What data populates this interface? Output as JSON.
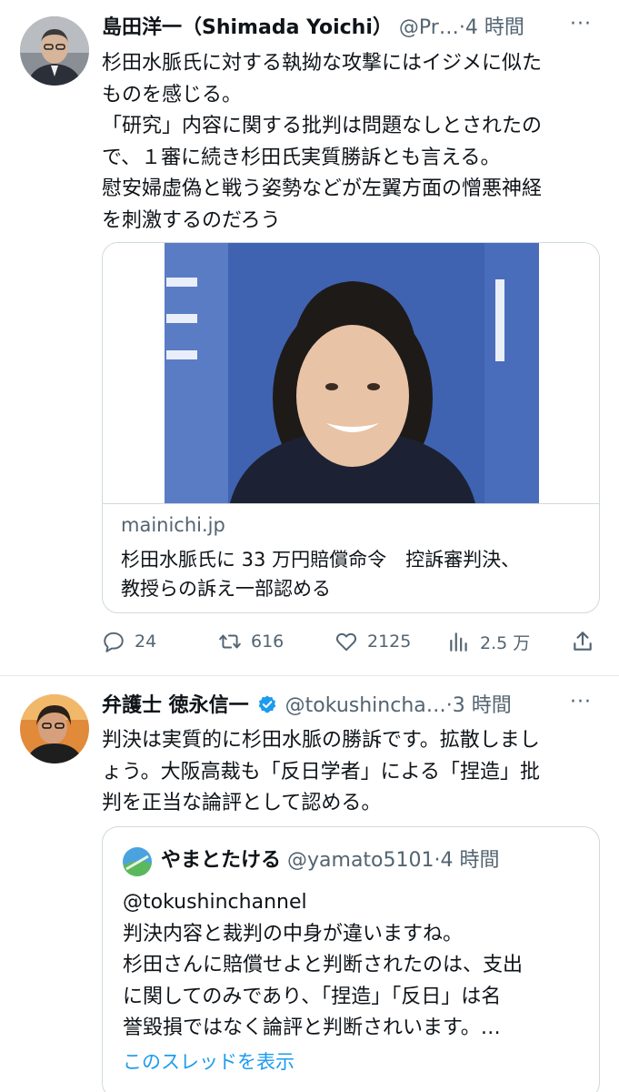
{
  "tweet1": {
    "name": "島田洋一（Shimada Yoichi）",
    "handle": "@Pr…",
    "dot": "·",
    "time": "4 時間",
    "more": "···",
    "lines": [
      "杉田水脈氏に対する執拗な攻撃にはイジメに似た",
      "ものを感じる。",
      "「研究」内容に関する批判は問題なしとされたの",
      "で、１審に続き杉田氏実質勝訴とも言える。",
      "慰安婦虚偽と戦う姿勢などが左翼方面の憎悪神経",
      "を刺激するのだろう"
    ],
    "card": {
      "domain": "mainichi.jp",
      "title_lines": [
        "杉田水脈氏に 33 万円賠償命令　控訴審判決、",
        "教授らの訴え一部認める"
      ]
    },
    "actions": {
      "reply_count": "24",
      "retweet_count": "616",
      "like_count": "2125",
      "views_count": "2.5 万"
    }
  },
  "tweet2": {
    "name": "弁護士 徳永信一",
    "handle": "@tokushincha…",
    "dot": "·",
    "time": "3 時間",
    "more": "···",
    "lines": [
      "判決は実質的に杉田水脈の勝訴です。拡散しまし",
      "ょう。大阪高裁も「反日学者」による「捏造」批",
      "判を正当な論評として認める。"
    ],
    "quote": {
      "name": "やまとたける",
      "handle": "@yamato5101",
      "dot": "·",
      "time": "4 時間",
      "lines": [
        "@tokushinchannel",
        "判決内容と裁判の中身が違いますね。",
        "杉田さんに賠償せよと判断されたのは、支出",
        "に関してのみであり、「捏造」「反日」は名",
        "誉毀損ではなく論評と判断されいます。…"
      ],
      "show_thread": "このスレッドを表示"
    }
  },
  "colors": {
    "text": "#0f1419",
    "secondary": "#536471",
    "border": "#cfd9de",
    "link": "#1d9bf0",
    "verified": "#1d9bf0"
  }
}
